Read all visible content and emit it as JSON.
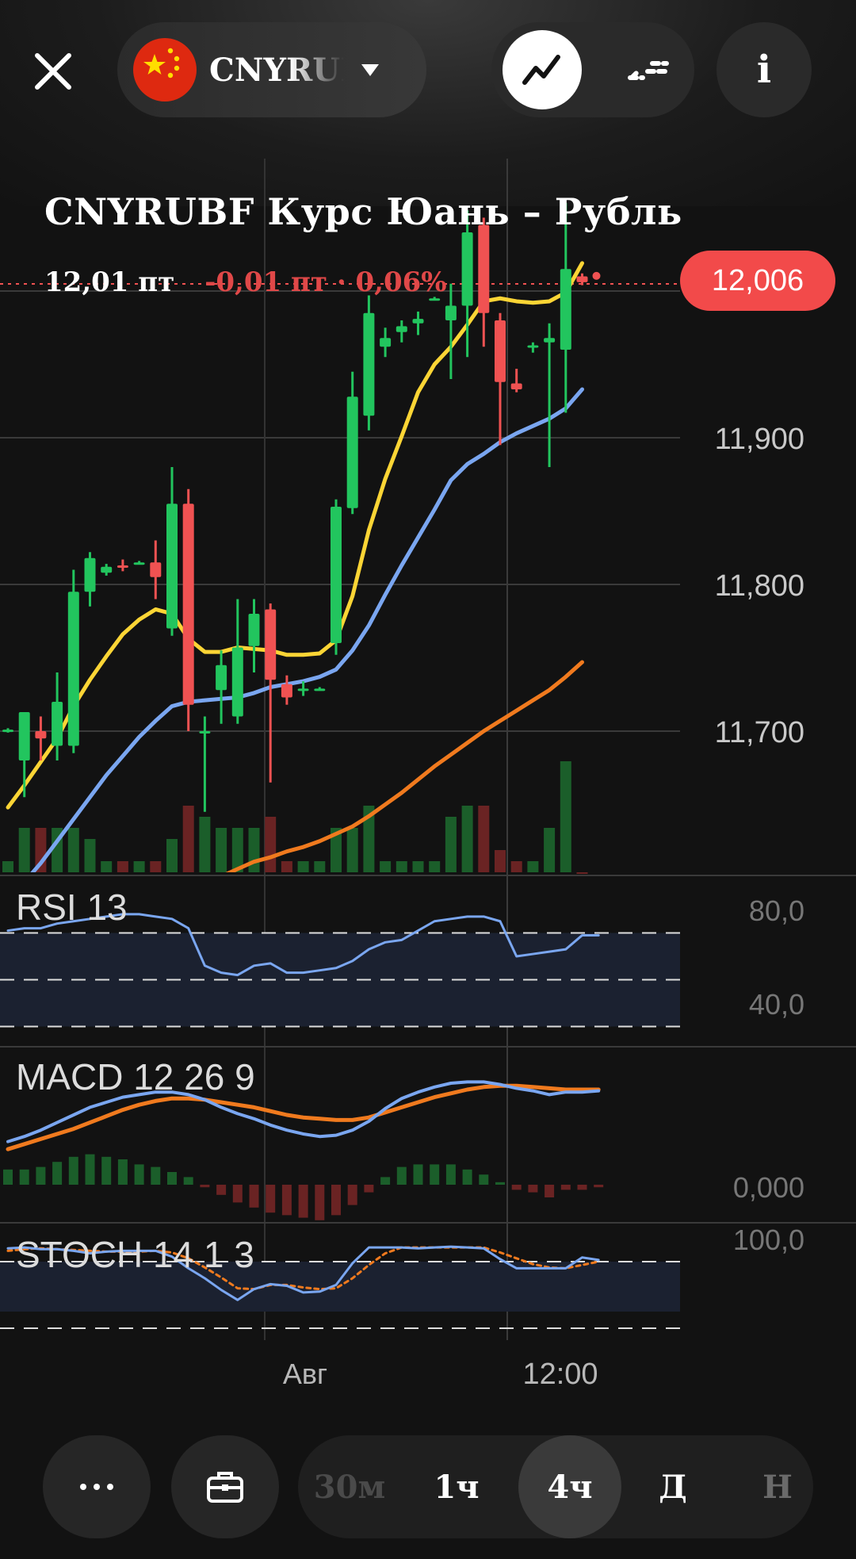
{
  "header": {
    "close_icon": "close-icon",
    "ticker_short": "CNYRUBF",
    "flag_icon": "china-flag-icon",
    "dropdown_icon": "caret-down-icon",
    "line_view_icon": "line-chart-icon",
    "candle_view_icon": "candle-chart-icon",
    "info_label": "i"
  },
  "instrument": {
    "title": "CNYRUBF Курс Юань – Рубль",
    "price": "12,01 пт",
    "change": "-0,01 пт · 0,06%",
    "last_price_badge": "12,006"
  },
  "colors": {
    "background": "#121212",
    "up": "#22c55e",
    "down": "#f05252",
    "ma_fast": "#fcd535",
    "ma_mid": "#7aa6f0",
    "ma_slow": "#f07a1e",
    "badge": "#f24a4a"
  },
  "chart_data": {
    "type": "candlestick",
    "y_ticks": [
      "11,900",
      "11,800",
      "11,700"
    ],
    "x_labels": [
      "Авг",
      "12:00"
    ],
    "last_price": 12.006,
    "ylim": [
      11.6,
      12.2
    ],
    "candles": [
      {
        "o": 11.7,
        "h": 11.702,
        "l": 11.699,
        "c": 11.701
      },
      {
        "o": 11.68,
        "h": 11.712,
        "l": 11.655,
        "c": 11.713
      },
      {
        "o": 11.7,
        "h": 11.71,
        "l": 11.68,
        "c": 11.695
      },
      {
        "o": 11.69,
        "h": 11.74,
        "l": 11.68,
        "c": 11.72
      },
      {
        "o": 11.69,
        "h": 11.81,
        "l": 11.685,
        "c": 11.795
      },
      {
        "o": 11.795,
        "h": 11.822,
        "l": 11.785,
        "c": 11.818
      },
      {
        "o": 11.808,
        "h": 11.814,
        "l": 11.806,
        "c": 11.812
      },
      {
        "o": 11.813,
        "h": 11.817,
        "l": 11.809,
        "c": 11.812
      },
      {
        "o": 11.815,
        "h": 11.816,
        "l": 11.814,
        "c": 11.815
      },
      {
        "o": 11.815,
        "h": 11.83,
        "l": 11.79,
        "c": 11.805
      },
      {
        "o": 11.77,
        "h": 11.88,
        "l": 11.765,
        "c": 11.855
      },
      {
        "o": 11.855,
        "h": 11.865,
        "l": 11.7,
        "c": 11.718
      },
      {
        "o": 11.7,
        "h": 11.71,
        "l": 11.645,
        "c": 11.7
      },
      {
        "o": 11.728,
        "h": 11.755,
        "l": 11.705,
        "c": 11.745
      },
      {
        "o": 11.71,
        "h": 11.79,
        "l": 11.705,
        "c": 11.757
      },
      {
        "o": 11.758,
        "h": 11.79,
        "l": 11.74,
        "c": 11.78
      },
      {
        "o": 11.783,
        "h": 11.787,
        "l": 11.665,
        "c": 11.735
      },
      {
        "o": 11.732,
        "h": 11.738,
        "l": 11.718,
        "c": 11.723
      },
      {
        "o": 11.728,
        "h": 11.734,
        "l": 11.724,
        "c": 11.729
      },
      {
        "o": 11.729,
        "h": 11.73,
        "l": 11.728,
        "c": 11.729
      },
      {
        "o": 11.76,
        "h": 11.858,
        "l": 11.752,
        "c": 11.853
      },
      {
        "o": 11.852,
        "h": 11.945,
        "l": 11.848,
        "c": 11.928
      },
      {
        "o": 11.915,
        "h": 11.997,
        "l": 11.905,
        "c": 11.985
      },
      {
        "o": 11.962,
        "h": 11.975,
        "l": 11.955,
        "c": 11.968
      },
      {
        "o": 11.972,
        "h": 11.98,
        "l": 11.965,
        "c": 11.976
      },
      {
        "o": 11.978,
        "h": 11.986,
        "l": 11.97,
        "c": 11.981
      },
      {
        "o": 11.995,
        "h": 11.996,
        "l": 11.994,
        "c": 11.995
      },
      {
        "o": 11.98,
        "h": 12.005,
        "l": 11.94,
        "c": 11.99
      },
      {
        "o": 11.99,
        "h": 12.055,
        "l": 11.955,
        "c": 12.04
      },
      {
        "o": 12.045,
        "h": 12.05,
        "l": 11.962,
        "c": 11.985
      },
      {
        "o": 11.98,
        "h": 11.985,
        "l": 11.895,
        "c": 11.938
      },
      {
        "o": 11.937,
        "h": 11.947,
        "l": 11.931,
        "c": 11.933
      },
      {
        "o": 11.962,
        "h": 11.965,
        "l": 11.958,
        "c": 11.963
      },
      {
        "o": 11.965,
        "h": 11.978,
        "l": 11.88,
        "c": 11.968
      },
      {
        "o": 11.96,
        "h": 12.06,
        "l": 11.917,
        "c": 12.015
      },
      {
        "o": 12.01,
        "h": 12.012,
        "l": 12.004,
        "c": 12.006
      }
    ],
    "volumes": [
      1,
      4,
      4,
      4,
      4,
      3,
      1,
      1,
      1,
      1,
      3,
      6,
      5,
      4,
      4,
      4,
      5,
      1,
      1,
      1,
      4,
      4,
      6,
      1,
      1,
      1,
      1,
      5,
      6,
      6,
      2,
      1,
      1,
      4,
      10,
      0
    ],
    "ma_fast": [
      11.648,
      11.663,
      11.679,
      11.695,
      11.717,
      11.735,
      11.751,
      11.766,
      11.776,
      11.783,
      11.78,
      11.763,
      11.754,
      11.754,
      11.757,
      11.756,
      11.755,
      11.752,
      11.752,
      11.753,
      11.762,
      11.792,
      11.837,
      11.872,
      11.901,
      11.931,
      11.95,
      11.962,
      11.977,
      11.993,
      11.995,
      11.993,
      11.992,
      11.993,
      11.999,
      12.019
    ],
    "ma_mid": [
      11.58,
      11.597,
      11.61,
      11.625,
      11.64,
      11.655,
      11.67,
      11.683,
      11.696,
      11.707,
      11.717,
      11.72,
      11.721,
      11.722,
      11.723,
      11.726,
      11.73,
      11.732,
      11.734,
      11.737,
      11.742,
      11.755,
      11.772,
      11.793,
      11.813,
      11.832,
      11.851,
      11.871,
      11.882,
      11.889,
      11.897,
      11.903,
      11.908,
      11.913,
      11.92,
      11.933
    ],
    "ma_slow": [
      11.545,
      11.55,
      11.555,
      11.56,
      11.565,
      11.568,
      11.572,
      11.576,
      11.58,
      11.584,
      11.588,
      11.592,
      11.597,
      11.601,
      11.606,
      11.611,
      11.614,
      11.618,
      11.621,
      11.625,
      11.63,
      11.635,
      11.642,
      11.65,
      11.658,
      11.667,
      11.676,
      11.684,
      11.692,
      11.7,
      11.707,
      11.714,
      11.721,
      11.728,
      11.737,
      11.747
    ],
    "rsi": {
      "label": "RSI 13",
      "ticks": [
        "80,0",
        "40,0"
      ],
      "levels": [
        70,
        50,
        30
      ],
      "range": [
        20,
        100
      ],
      "values": [
        71,
        72,
        72,
        74,
        75,
        76,
        77,
        78,
        78,
        77,
        76,
        72,
        56,
        53,
        52,
        56,
        57,
        53,
        53,
        54,
        55,
        58,
        63,
        66,
        67,
        71,
        75,
        76,
        77,
        77,
        75,
        60,
        61,
        62,
        63,
        69,
        69
      ]
    },
    "macd": {
      "label": "MACD 12 26 9",
      "ticks": [
        "0,000"
      ],
      "macd": [
        0.034,
        0.038,
        0.043,
        0.049,
        0.055,
        0.061,
        0.065,
        0.069,
        0.071,
        0.073,
        0.073,
        0.071,
        0.067,
        0.061,
        0.056,
        0.052,
        0.047,
        0.043,
        0.04,
        0.038,
        0.039,
        0.043,
        0.05,
        0.06,
        0.068,
        0.073,
        0.077,
        0.08,
        0.081,
        0.081,
        0.079,
        0.076,
        0.074,
        0.071,
        0.073,
        0.073,
        0.074
      ],
      "signal": [
        0.028,
        0.032,
        0.036,
        0.04,
        0.044,
        0.049,
        0.054,
        0.059,
        0.063,
        0.066,
        0.068,
        0.068,
        0.067,
        0.065,
        0.063,
        0.061,
        0.058,
        0.055,
        0.053,
        0.052,
        0.051,
        0.051,
        0.053,
        0.057,
        0.061,
        0.065,
        0.069,
        0.072,
        0.075,
        0.077,
        0.078,
        0.078,
        0.077,
        0.076,
        0.075,
        0.075,
        0.075
      ],
      "hist": [
        6,
        6,
        7,
        9,
        11,
        12,
        11,
        10,
        8,
        7,
        5,
        3,
        -1,
        -4,
        -7,
        -9,
        -11,
        -12,
        -13,
        -14,
        -12,
        -8,
        -3,
        3,
        7,
        8,
        8,
        8,
        6,
        4,
        1,
        -2,
        -3,
        -5,
        -2,
        -2,
        -1
      ]
    },
    "stoch": {
      "label": "STOCH 14 1 3",
      "ticks": [
        "100,0"
      ],
      "levels": [
        80,
        20
      ],
      "range": [
        0,
        100
      ],
      "k": [
        96,
        97,
        95,
        95,
        93,
        90,
        92,
        93,
        93,
        93,
        86,
        72,
        60,
        46,
        34,
        47,
        53,
        51,
        43,
        44,
        52,
        78,
        97,
        97,
        97,
        96,
        97,
        98,
        97,
        96,
        83,
        72,
        72,
        72,
        72,
        85,
        82
      ],
      "d": [
        93,
        95,
        96,
        95,
        94,
        93,
        92,
        92,
        92,
        93,
        91,
        84,
        73,
        61,
        48,
        47,
        52,
        52,
        49,
        47,
        48,
        60,
        76,
        90,
        97,
        97,
        97,
        97,
        97,
        97,
        91,
        84,
        77,
        73,
        72,
        76,
        80
      ]
    }
  },
  "timeframes": {
    "items": [
      "30м",
      "1ч",
      "4ч",
      "Д",
      "Н"
    ],
    "active": "4ч"
  },
  "bottom": {
    "more_icon": "more-icon",
    "portfolio_icon": "briefcase-icon"
  }
}
